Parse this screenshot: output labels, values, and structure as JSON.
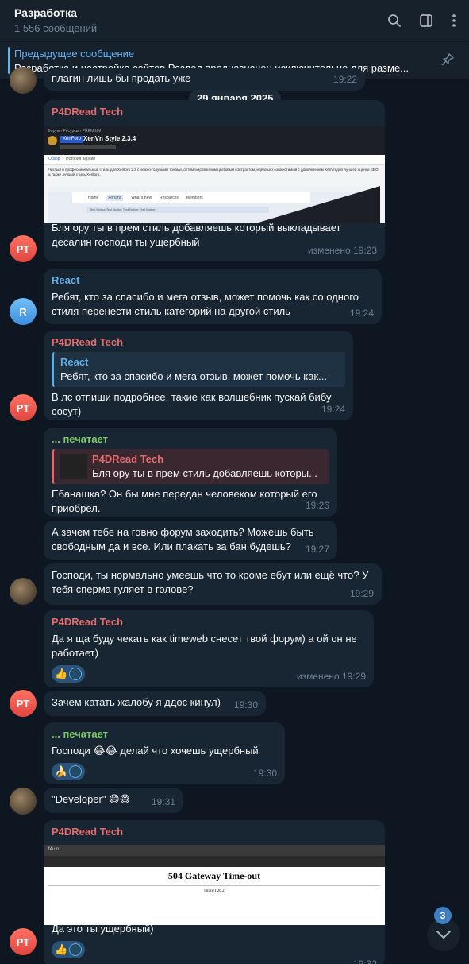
{
  "header": {
    "title": "Разработка",
    "subtitle": "1 556 сообщений"
  },
  "pinned": {
    "title": "Предыдущее сообщение",
    "text": "Разработка и настройка сайтов  Раздел предназначен исключительно для разме..."
  },
  "partial_top": {
    "text": "плагин лишь бы продать уже",
    "time": "19:22"
  },
  "date_badge": "29 января 2025",
  "messages": [
    {
      "sender": "P4DRead Tech",
      "image": {
        "breadcrumb": "Форум › Ресурсы › PREMIUM",
        "product": "XenVn Style 2.3.4",
        "tag": "XenForo",
        "tabs": [
          "Обзор",
          "История версий"
        ],
        "desc": "Чистый и профессиональный стиль для Xenforo 2.3 с нежно-голубыми тонами, оптимизированным цветовым контрастом, идеально совместимый с дополнением XenVn для лучшей оценки SEO, а также лучший стиль Xenforo.",
        "nav": [
          "Home",
          "Forums",
          "What's new",
          "Resources",
          "Members"
        ],
        "notice": "Test Notice/Test Notice Test Notice Test Notice"
      },
      "text": "Бля ору ты в прем стиль добавляешь который выкладывает десалин господи ты ущербный",
      "time": "изменено 19:23",
      "avatar": "PT"
    },
    {
      "sender": "React",
      "text": "Ребят, кто за спасибо и мега отзыв, может помочь как со одного стиля перенести стиль категорий на другой стиль",
      "time": "19:24",
      "avatar": "R"
    },
    {
      "sender": "P4DRead Tech",
      "reply": {
        "name": "React",
        "text": "Ребят, кто за спасибо и мега отзыв, может помочь как..."
      },
      "text": "В лс отпиши подробнее, такие как волшебник пускай бибу сосут)",
      "time": "19:24",
      "avatar": "PT"
    },
    {
      "sender": "... печатает",
      "reply": {
        "name": "P4DRead Tech",
        "text": "Бля ору ты в прем стиль добавляешь которы..."
      },
      "text": "Ебанашка? Он бы мне передан человеком который его приобрел.",
      "time": "19:26"
    },
    {
      "text": "А зачем тебе на говно форум заходить? Можешь быть свободным да и все. Или плакать за бан будешь?",
      "time": "19:27"
    },
    {
      "text": "Господи, ты нормально умеешь что то кроме ебут или ещё что? У тебя сперма гуляет в голове?",
      "time": "19:29"
    },
    {
      "sender": "P4DRead Tech",
      "text": "Да я ща буду чекать как timeweb снесет твой форум) а ой он не работает)",
      "reactions": [
        "👍"
      ],
      "time": "изменено 19:29"
    },
    {
      "text": "Зачем катать жалобу я ддос кинул)",
      "time": "19:30",
      "avatar": "PT"
    },
    {
      "sender": "... печатает",
      "text": "Господи 😂😂 делай что хочешь ущербный",
      "reactions": [
        "🍌"
      ],
      "time": "19:30"
    },
    {
      "text": "\"Developer\" 😄😅",
      "time": "19:31"
    },
    {
      "sender": "P4DRead Tech",
      "image": {
        "url": "f4u.ru",
        "heading": "504 Gateway Time-out",
        "server": "nginx/1.26.2"
      },
      "text": "Да это ты ущербный)",
      "reactions": [
        "👍"
      ],
      "time": "19:32",
      "avatar": "PT"
    }
  ],
  "scroll": {
    "unread": "3"
  }
}
